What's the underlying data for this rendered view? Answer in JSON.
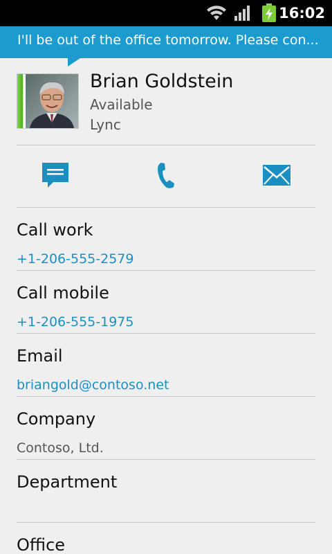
{
  "status_bar": {
    "time": "16:02",
    "icons": [
      "wifi-icon",
      "signal-icon",
      "battery-charging-icon"
    ]
  },
  "note": {
    "text": "I'll be out of the office tomorrow. Please con..."
  },
  "contact": {
    "name": "Brian Goldstein",
    "status": "Available",
    "source": "Lync",
    "presence_color": "#5cbf2a"
  },
  "actions": [
    {
      "name": "message",
      "icon": "chat-bubble-icon"
    },
    {
      "name": "call",
      "icon": "phone-icon"
    },
    {
      "name": "email",
      "icon": "envelope-icon"
    }
  ],
  "details": [
    {
      "label": "Call work",
      "value": "+1-206-555-2579"
    },
    {
      "label": "Call mobile",
      "value": "+1-206-555-1975"
    },
    {
      "label": "Email",
      "value": "briangold@contoso.net"
    },
    {
      "label": "Company",
      "value": "Contoso, Ltd."
    },
    {
      "label": "Department",
      "value": ""
    },
    {
      "label": "Office",
      "value": ""
    }
  ],
  "colors": {
    "accent": "#1c9bcf",
    "link": "#1c8fc2",
    "background": "#efefef"
  }
}
